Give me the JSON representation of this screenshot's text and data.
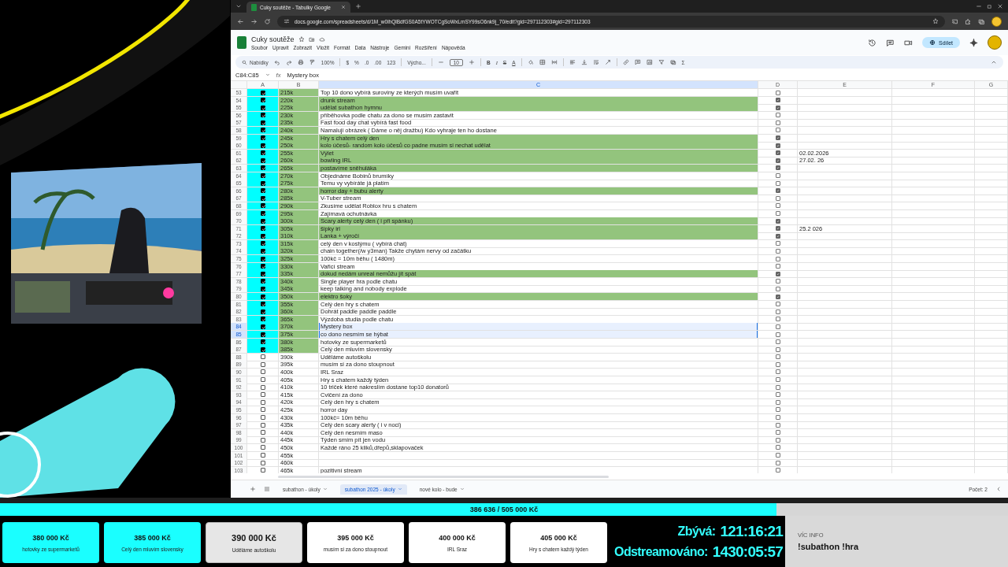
{
  "browser": {
    "tab_title": "Cuky soutěže - Tabulky Google",
    "url": "docs.google.com/spreadsheets/d/1M_w0ihQlBdfGS0A5tYWOTCgSoWxLmSY99sO6nk9j_70/edit?gid=297112303#gid=297112303"
  },
  "document": {
    "title": "Cuky soutěže",
    "menus": [
      "Soubor",
      "Upravit",
      "Zobrazit",
      "Vložit",
      "Formát",
      "Data",
      "Nástroje",
      "Gemini",
      "Rozšíření",
      "Nápověda"
    ],
    "share_button": "Sdílet"
  },
  "toolbar": {
    "menu_search": "Nabídky",
    "zoom": "100%",
    "currency": "$",
    "percent": "%",
    "decrease_decimals": ".0",
    "increase_decimals": ".00",
    "number_format": "123",
    "font": "Výcho...",
    "font_size": "10",
    "bold": "B",
    "italic": "I",
    "strikethrough": "S",
    "text_color": "A",
    "functions": "Σ"
  },
  "formula_bar": {
    "range": "C84:C85",
    "fx_label": "fx",
    "value": "Mystery box"
  },
  "columns": [
    {
      "label": "A",
      "selected": false
    },
    {
      "label": "B",
      "selected": false
    },
    {
      "label": "C",
      "selected": true
    },
    {
      "label": "D",
      "selected": false
    },
    {
      "label": "E",
      "selected": false
    },
    {
      "label": "F",
      "selected": false
    },
    {
      "label": "G",
      "selected": false
    }
  ],
  "rows": [
    {
      "number": "53",
      "a_checked": true,
      "b": "215k",
      "c": "Top 10 dono vybírá suroviny ze kterých musím uvařit",
      "d_checked": false,
      "selected": false
    },
    {
      "number": "54",
      "a_checked": true,
      "b": "220k",
      "c": "drunk stream",
      "d_checked": true,
      "selected": false
    },
    {
      "number": "55",
      "a_checked": true,
      "b": "225k",
      "c": "udělat subathon hymnu",
      "d_checked": true,
      "selected": false
    },
    {
      "number": "56",
      "a_checked": true,
      "b": "230k",
      "c": "příběhovka podle chatu za dono se musím zastavit",
      "d_checked": false,
      "selected": false
    },
    {
      "number": "57",
      "a_checked": true,
      "b": "235k",
      "c": "Fast food day chat vybírá fast food",
      "d_checked": false,
      "selected": false
    },
    {
      "number": "58",
      "a_checked": true,
      "b": "240k",
      "c": "Namaluji obrázek ( Dáme o něj dražbu) Kdo vyhraje ten ho dostane",
      "d_checked": false,
      "selected": false
    },
    {
      "number": "59",
      "a_checked": true,
      "b": "245k",
      "c": "Hry s chatem celý den",
      "d_checked": true,
      "selected": false
    },
    {
      "number": "60",
      "a_checked": true,
      "b": "250k",
      "c": "kolo účesů- random kolo účesů co padne musím si nechat udělat",
      "d_checked": true,
      "selected": false
    },
    {
      "number": "61",
      "a_checked": true,
      "b": "255k",
      "c": "Výlet",
      "d_checked": true,
      "e": "02.02.2026",
      "selected": false
    },
    {
      "number": "62",
      "a_checked": true,
      "b": "260k",
      "c": "bowling IRL",
      "d_checked": true,
      "e": "27.02. 26",
      "selected": false
    },
    {
      "number": "63",
      "a_checked": true,
      "b": "265k",
      "c": "postavíme sněhuláka",
      "d_checked": true,
      "selected": false
    },
    {
      "number": "64",
      "a_checked": true,
      "b": "270k",
      "c": "Objednáme Bobinů brumíky",
      "d_checked": false,
      "selected": false
    },
    {
      "number": "65",
      "a_checked": true,
      "b": "275k",
      "c": "Temu vy vybíráte já platím",
      "d_checked": false,
      "selected": false
    },
    {
      "number": "66",
      "a_checked": true,
      "b": "280k",
      "c": "horror day + bubu alerty",
      "d_checked": true,
      "selected": false
    },
    {
      "number": "67",
      "a_checked": true,
      "b": "285k",
      "c": "V-Tuber stream",
      "d_checked": false,
      "selected": false
    },
    {
      "number": "68",
      "a_checked": true,
      "b": "290k",
      "c": "Zkusíme udělat Roblox hru s chatem",
      "d_checked": false,
      "selected": false
    },
    {
      "number": "69",
      "a_checked": true,
      "b": "295k",
      "c": "Zajímavá ochutnávka",
      "d_checked": false,
      "selected": false
    },
    {
      "number": "70",
      "a_checked": true,
      "b": "300k",
      "c": "Scary alerty celý den ( i při spánku)",
      "d_checked": true,
      "selected": false
    },
    {
      "number": "71",
      "a_checked": true,
      "b": "305k",
      "c": "šipky irl",
      "d_checked": true,
      "e": "25.2 026",
      "selected": false
    },
    {
      "number": "72",
      "a_checked": true,
      "b": "310k",
      "c": "Lanka + výročí",
      "d_checked": true,
      "selected": false
    },
    {
      "number": "73",
      "a_checked": true,
      "b": "315k",
      "c": "celý den v kostýmu ( vybírá chat)",
      "d_checked": false,
      "selected": false
    },
    {
      "number": "74",
      "a_checked": true,
      "b": "320k",
      "c": "chain together(/w y3man) Takže chytám nervy od začátku",
      "d_checked": false,
      "selected": false
    },
    {
      "number": "75",
      "a_checked": true,
      "b": "325k",
      "c": "100kč = 10m běhu ( 1480m)",
      "d_checked": false,
      "selected": false
    },
    {
      "number": "76",
      "a_checked": true,
      "b": "330k",
      "c": "Vařicí stream",
      "d_checked": false,
      "selected": false
    },
    {
      "number": "77",
      "a_checked": true,
      "b": "335k",
      "c": "dokud nedám unreal nemůžu jít spát",
      "d_checked": true,
      "selected": false
    },
    {
      "number": "78",
      "a_checked": true,
      "b": "340k",
      "c": "Single player hra podle chatu",
      "d_checked": false,
      "selected": false
    },
    {
      "number": "79",
      "a_checked": true,
      "b": "345k",
      "c": "keep talking and nobody explode",
      "d_checked": false,
      "selected": false
    },
    {
      "number": "80",
      "a_checked": true,
      "b": "350k",
      "c": "elektro šoky",
      "d_checked": true,
      "selected": false
    },
    {
      "number": "81",
      "a_checked": true,
      "b": "355k",
      "c": "Celý den hry s chatem",
      "d_checked": false,
      "selected": false
    },
    {
      "number": "82",
      "a_checked": true,
      "b": "360k",
      "c": "Dohrát paddle paddle paddle",
      "d_checked": false,
      "selected": false
    },
    {
      "number": "83",
      "a_checked": true,
      "b": "365k",
      "c": "Výzdoba studia podle chatu",
      "d_checked": false,
      "selected": false
    },
    {
      "number": "84",
      "a_checked": true,
      "b": "370k",
      "c": "Mystery box",
      "d_checked": false,
      "selected": true
    },
    {
      "number": "85",
      "a_checked": true,
      "b": "375k",
      "c": "co dono nesmím se hýbat",
      "d_checked": false,
      "selected": true
    },
    {
      "number": "86",
      "a_checked": true,
      "b": "380k",
      "c": "hotovky ze supermarketů",
      "d_checked": false,
      "selected": false
    },
    {
      "number": "87",
      "a_checked": true,
      "b": "385k",
      "c": "Celý den mluvím slovensky",
      "d_checked": false,
      "selected": false
    },
    {
      "number": "88",
      "a_checked": false,
      "b": "390k",
      "c": "Uděláme autoškolu",
      "d_checked": false,
      "selected": false
    },
    {
      "number": "89",
      "a_checked": false,
      "b": "395k",
      "c": "musím si za dono stoupnout",
      "d_checked": false,
      "selected": false
    },
    {
      "number": "90",
      "a_checked": false,
      "b": "400k",
      "c": "IRL Sraz",
      "d_checked": false,
      "selected": false
    },
    {
      "number": "91",
      "a_checked": false,
      "b": "405k",
      "c": "Hry s chatem každý týden",
      "d_checked": false,
      "selected": false
    },
    {
      "number": "92",
      "a_checked": false,
      "b": "410k",
      "c": "10 triček které nakreslím dostane top10 donatorů",
      "d_checked": false,
      "selected": false
    },
    {
      "number": "93",
      "a_checked": false,
      "b": "415k",
      "c": "Cvičení za dono",
      "d_checked": false,
      "selected": false
    },
    {
      "number": "94",
      "a_checked": false,
      "b": "420k",
      "c": "Celý den hry s chatem",
      "d_checked": false,
      "selected": false
    },
    {
      "number": "95",
      "a_checked": false,
      "b": "425k",
      "c": "horror day",
      "d_checked": false,
      "selected": false
    },
    {
      "number": "96",
      "a_checked": false,
      "b": "430k",
      "c": "100kč= 10m běhu",
      "d_checked": false,
      "selected": false
    },
    {
      "number": "97",
      "a_checked": false,
      "b": "435k",
      "c": "Celý den scary alerty ( i v noci)",
      "d_checked": false,
      "selected": false
    },
    {
      "number": "98",
      "a_checked": false,
      "b": "440k",
      "c": "Celý den nesmím maso",
      "d_checked": false,
      "selected": false
    },
    {
      "number": "99",
      "a_checked": false,
      "b": "445k",
      "c": "Týden smím pít jen vodu",
      "d_checked": false,
      "selected": false
    },
    {
      "number": "100",
      "a_checked": false,
      "b": "450k",
      "c": "Každé ráno 25 kliků,dřepů,sklapovaček",
      "d_checked": false,
      "selected": false
    },
    {
      "number": "101",
      "a_checked": false,
      "b": "455k",
      "d_checked": false,
      "selected": false
    },
    {
      "number": "102",
      "a_checked": false,
      "b": "460k",
      "d_checked": false,
      "selected": false
    },
    {
      "number": "103",
      "a_checked": false,
      "b": "465k",
      "c": "pozitivní stream",
      "d_checked": false,
      "selected": false
    }
  ],
  "sheet_tabs": [
    {
      "label": "subathon - úkoly",
      "selected": false
    },
    {
      "label": "subathon 2025 - úkoly",
      "selected": true
    },
    {
      "label": "nové kolo - bude",
      "selected": false
    }
  ],
  "status": "Počet: 2",
  "overlay": {
    "progress": {
      "text": "386 636 / 505 000 Kč",
      "level": 0.77
    },
    "goals": [
      {
        "amount": "380 000 Kč",
        "label": "hotovky ze supermarketů",
        "reached": true,
        "selected": false
      },
      {
        "amount": "385 000 Kč",
        "label": "Celý den mluvím slovensky",
        "reached": true,
        "selected": false
      },
      {
        "amount": "390 000 Kč",
        "label": "Uděláme autoškolu",
        "reached": false,
        "selected": true
      },
      {
        "amount": "395 000 Kč",
        "label": "musím si za dono stoupnout",
        "reached": false,
        "selected": false
      },
      {
        "amount": "400 000 Kč",
        "label": "IRL Sraz",
        "reached": false,
        "selected": false
      },
      {
        "amount": "405 000 Kč",
        "label": "Hry s chatem každý týden",
        "reached": false,
        "selected": false
      }
    ],
    "timers": [
      {
        "label": "Zbývá:",
        "value": "121:16:21"
      },
      {
        "label": "Odstreamováno:",
        "value": "1430:05:57"
      }
    ],
    "info": {
      "heading": "VÍC INFO",
      "text": "!subathon !hra"
    }
  }
}
